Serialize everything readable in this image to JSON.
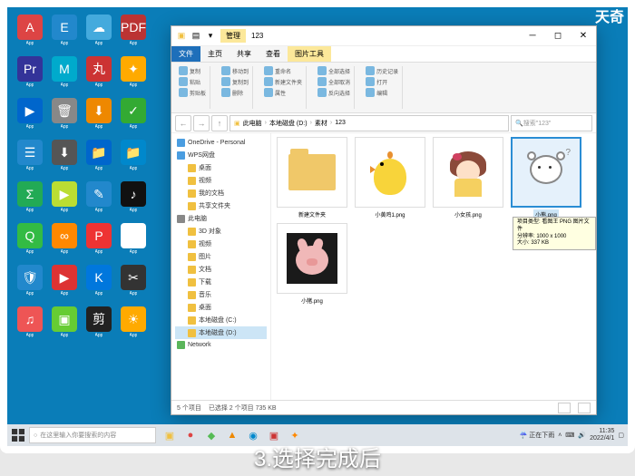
{
  "brand": "天奇",
  "caption": "3.选择完成后",
  "explorer": {
    "title": "123",
    "context_tab_group": "管理",
    "context_tab": "图片工具",
    "tabs": {
      "file": "文件",
      "home": "主页",
      "share": "共享",
      "view": "查看"
    },
    "ribbon_items": [
      "复制",
      "粘贴",
      "剪贴板",
      "移动到",
      "复制到",
      "删除",
      "重命名",
      "新建文件夹",
      "属性",
      "全部选择",
      "全部取消",
      "反向选择",
      "历史记录",
      "打开",
      "编辑"
    ],
    "breadcrumbs": [
      "此电脑",
      "本地磁盘 (D:)",
      "素材",
      "123"
    ],
    "search_placeholder": "搜索\"123\"",
    "nav": {
      "onedrive": "OneDrive - Personal",
      "wps": "WPS网盘",
      "quick": [
        "桌面",
        "视频",
        "我的文档",
        "共享文件夹"
      ],
      "thispc": "此电脑",
      "thispc_items": [
        "3D 对象",
        "视频",
        "图片",
        "文档",
        "下载",
        "音乐",
        "桌面",
        "本地磁盘 (C:)",
        "本地磁盘 (D:)"
      ],
      "network": "Network"
    },
    "items": [
      {
        "name": "新建文件夹",
        "type": "folder"
      },
      {
        "name": "小黄鸡1.png",
        "type": "chick"
      },
      {
        "name": "小女孩.png",
        "type": "girl"
      },
      {
        "name": "小熊.png",
        "type": "bear",
        "selected": true
      },
      {
        "name": "小猪.png",
        "type": "pig"
      }
    ],
    "tooltip": {
      "l1": "项目类型: 看图王 PNG 图片文件",
      "l2": "分辨率: 1000 x 1000",
      "l3": "大小: 337 KB"
    },
    "status": {
      "count": "5 个项目",
      "selected": "已选择 2 个项目  735 KB"
    }
  },
  "taskbar": {
    "search": "在这里输入你要搜索的内容",
    "weather": "正在下雨",
    "time": "11:35",
    "date": "2022/4/1"
  },
  "desktop_icons": [
    {
      "bg": "#d44",
      "t": "A"
    },
    {
      "bg": "#28c",
      "t": "E"
    },
    {
      "bg": "#4ad",
      "t": "☁"
    },
    {
      "bg": "#b33",
      "t": "PDF"
    },
    {
      "bg": "#339",
      "t": "Pr"
    },
    {
      "bg": "#0ac",
      "t": "M"
    },
    {
      "bg": "#c33",
      "t": "丸"
    },
    {
      "bg": "#fa0",
      "t": "✦"
    },
    {
      "bg": "#06c",
      "t": "▶"
    },
    {
      "bg": "#888",
      "t": "🗑"
    },
    {
      "bg": "#e80",
      "t": "⬇"
    },
    {
      "bg": "#3a3",
      "t": "✓"
    },
    {
      "bg": "#28c",
      "t": "☰"
    },
    {
      "bg": "#555",
      "t": "⬇"
    },
    {
      "bg": "#06c",
      "t": "📁"
    },
    {
      "bg": "#08c",
      "t": "📁"
    },
    {
      "bg": "#2a5",
      "t": "Σ"
    },
    {
      "bg": "#bd3",
      "t": "▶"
    },
    {
      "bg": "#28c",
      "t": "✎"
    },
    {
      "bg": "#111",
      "t": "♪"
    },
    {
      "bg": "#3b4",
      "t": "Q"
    },
    {
      "bg": "#f80",
      "t": "∞"
    },
    {
      "bg": "#e33",
      "t": "P"
    },
    {
      "bg": "#fff",
      "t": "☰"
    },
    {
      "bg": "#28c",
      "t": "🛡"
    },
    {
      "bg": "#d33",
      "t": "▶"
    },
    {
      "bg": "#07d",
      "t": "K"
    },
    {
      "bg": "#333",
      "t": "✂"
    },
    {
      "bg": "#e55",
      "t": "♫"
    },
    {
      "bg": "#6c3",
      "t": "▣"
    },
    {
      "bg": "#222",
      "t": "剪"
    },
    {
      "bg": "#fa0",
      "t": "☀"
    }
  ]
}
